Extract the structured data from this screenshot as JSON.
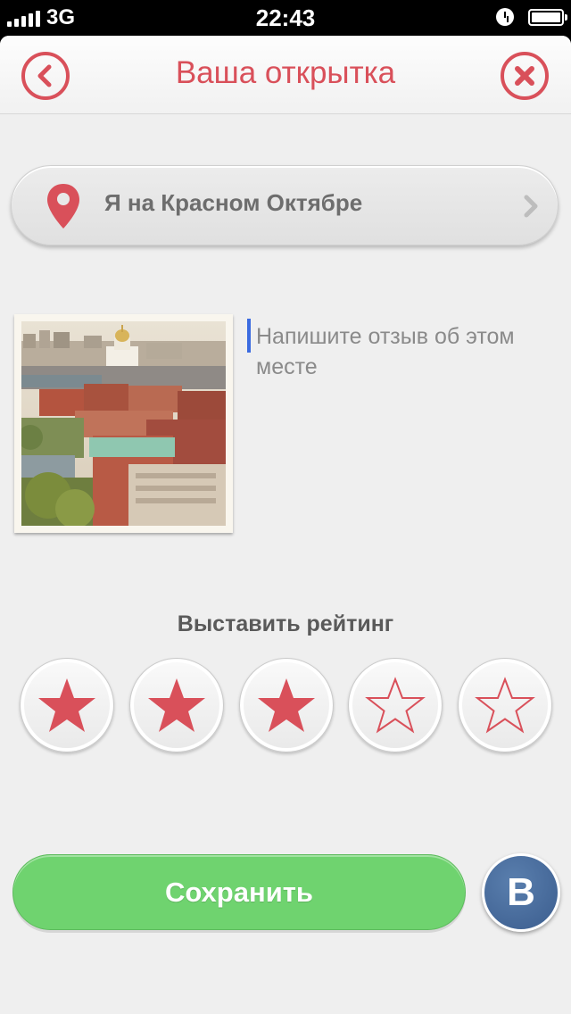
{
  "status_bar": {
    "carrier": "3G",
    "time": "22:43",
    "icons": [
      "signal-icon",
      "alarm-icon",
      "battery-icon"
    ]
  },
  "nav": {
    "title": "Ваша открытка",
    "back_icon": "chevron-left-icon",
    "close_icon": "close-icon"
  },
  "location": {
    "label": "Я на Красном Октябре",
    "icon": "map-pin-icon",
    "chevron": "chevron-right-icon"
  },
  "review": {
    "placeholder": "Напишите отзыв об этом месте",
    "value": ""
  },
  "rating": {
    "title": "Выставить рейтинг",
    "value": 3,
    "max": 5
  },
  "actions": {
    "save_label": "Сохранить",
    "vk_label": "B"
  },
  "colors": {
    "accent": "#d9505a",
    "save": "#6fd36f",
    "vk": "#3b5d8e"
  }
}
